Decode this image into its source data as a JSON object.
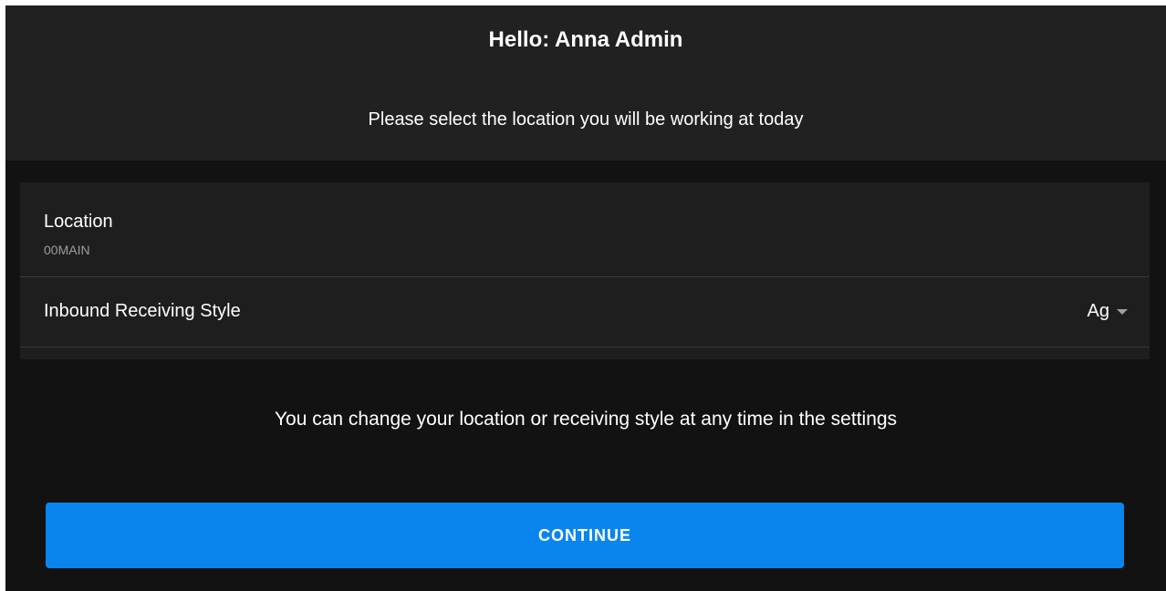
{
  "header": {
    "greeting": "Hello: Anna Admin",
    "subtitle": "Please select the location you will be working at today"
  },
  "settings": {
    "location": {
      "label": "Location",
      "value": "00MAIN"
    },
    "receiving_style": {
      "label": "Inbound Receiving Style",
      "selected": "Ag",
      "icon": "chevron-down-icon"
    }
  },
  "info_text": "You can change your location or receiving style at any time in the settings",
  "continue_label": "CONTINUE",
  "colors": {
    "background": "#121212",
    "header_background": "#212121",
    "card_background": "#1e1e1e",
    "accent": "#0a85ee",
    "muted_text": "#9e9e9e"
  }
}
